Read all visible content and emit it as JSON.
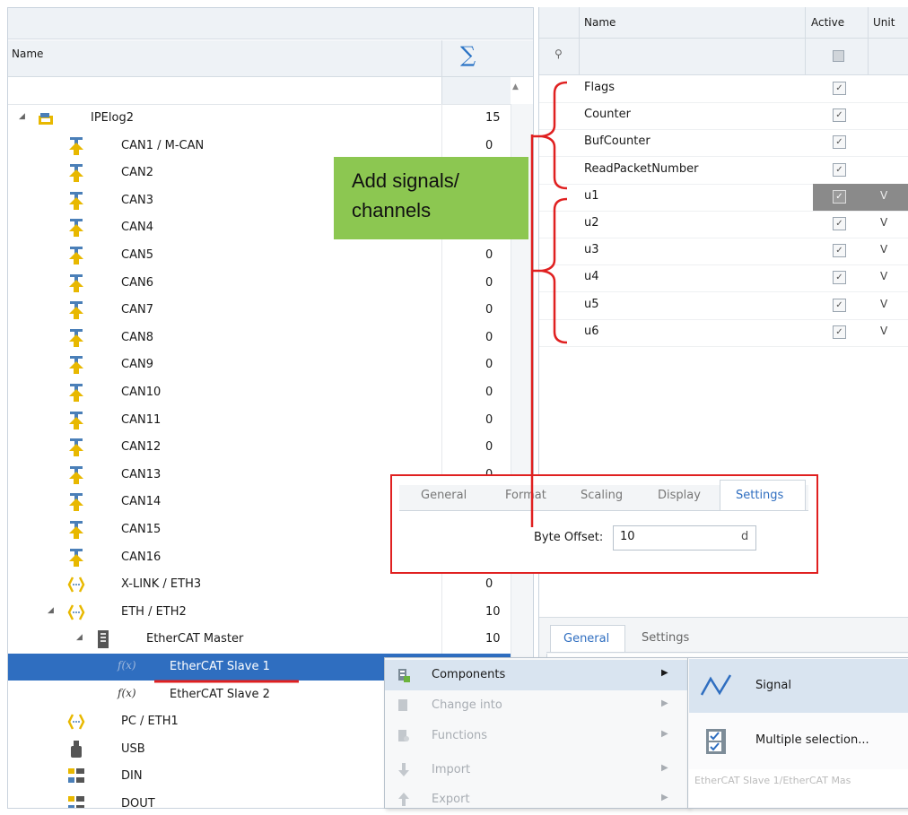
{
  "tree": {
    "header_name": "Name",
    "sum_symbol": "∑",
    "rows": [
      {
        "label": "IPElog2",
        "count": "15"
      },
      {
        "label": "CAN1 / M-CAN",
        "count": "0"
      },
      {
        "label": "CAN2",
        "count": ""
      },
      {
        "label": "CAN3",
        "count": ""
      },
      {
        "label": "CAN4",
        "count": ""
      },
      {
        "label": "CAN5",
        "count": "0"
      },
      {
        "label": "CAN6",
        "count": "0"
      },
      {
        "label": "CAN7",
        "count": "0"
      },
      {
        "label": "CAN8",
        "count": "0"
      },
      {
        "label": "CAN9",
        "count": "0"
      },
      {
        "label": "CAN10",
        "count": "0"
      },
      {
        "label": "CAN11",
        "count": "0"
      },
      {
        "label": "CAN12",
        "count": "0"
      },
      {
        "label": "CAN13",
        "count": "0"
      },
      {
        "label": "CAN14",
        "count": ""
      },
      {
        "label": "CAN15",
        "count": ""
      },
      {
        "label": "CAN16",
        "count": ""
      },
      {
        "label": "X-LINK / ETH3",
        "count": "0"
      },
      {
        "label": "ETH / ETH2",
        "count": "10"
      },
      {
        "label": "EtherCAT Master",
        "count": "10"
      },
      {
        "label": "EtherCAT Slave 1",
        "count": ""
      },
      {
        "label": "EtherCAT Slave 2",
        "count": ""
      },
      {
        "label": "PC / ETH1",
        "count": ""
      },
      {
        "label": "USB",
        "count": ""
      },
      {
        "label": "DIN",
        "count": ""
      },
      {
        "label": "DOUT",
        "count": ""
      }
    ],
    "fx_label": "f(x)"
  },
  "grid": {
    "col_name": "Name",
    "col_active": "Active",
    "col_unit": "Unit",
    "rows": [
      {
        "name": "Flags",
        "unit": ""
      },
      {
        "name": "Counter",
        "unit": ""
      },
      {
        "name": "BufCounter",
        "unit": ""
      },
      {
        "name": "ReadPacketNumber",
        "unit": ""
      },
      {
        "name": "u1",
        "unit": "V"
      },
      {
        "name": "u2",
        "unit": "V"
      },
      {
        "name": "u3",
        "unit": "V"
      },
      {
        "name": "u4",
        "unit": "V"
      },
      {
        "name": "u5",
        "unit": "V"
      },
      {
        "name": "u6",
        "unit": "V"
      }
    ]
  },
  "properties": {
    "tabs": [
      "General",
      "Format",
      "Scaling",
      "Display",
      "Settings"
    ],
    "byte_offset_label": "Byte Offset:",
    "byte_offset_value": "10",
    "byte_offset_unit": "d"
  },
  "bottom_tabs": {
    "general": "General",
    "settings": "Settings"
  },
  "context_menu": {
    "items": [
      {
        "label": "Components"
      },
      {
        "label": "Change into"
      },
      {
        "label": "Functions"
      },
      {
        "label": "Import"
      },
      {
        "label": "Export"
      }
    ]
  },
  "submenu": {
    "signal": "Signal",
    "multiple": "Multiple selection...",
    "footer": "EtherCAT Slave 1/EtherCAT Mas"
  },
  "annotation": {
    "line1": "Add signals/",
    "line2": "channels"
  },
  "colors": {
    "accent": "#2f6ec0",
    "annotation_red": "#e02020",
    "annotation_green": "#8cc751",
    "icon_gold": "#e8b800",
    "icon_blue": "#4a7fb8"
  }
}
